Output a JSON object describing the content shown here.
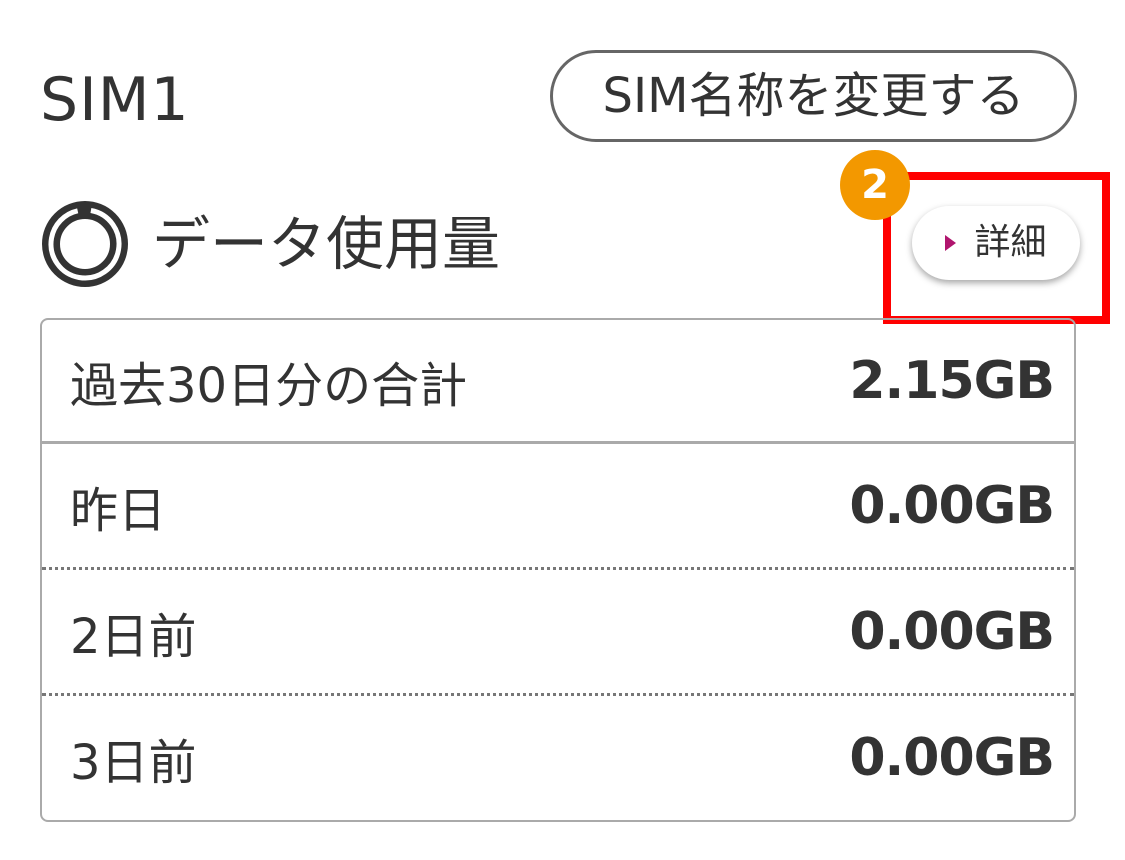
{
  "sim": {
    "title": "SIM1",
    "rename_label": "SIM名称を変更する"
  },
  "usage": {
    "icon": "donut-chart-icon",
    "title": "データ使用量",
    "detail_label": "詳細",
    "detail_icon": "play-triangle-icon",
    "accent_color": "#b0156e"
  },
  "annotation": {
    "step": "2",
    "badge_color": "#f39800",
    "highlight_color": "#ff0000"
  },
  "table": {
    "total": {
      "label": "過去30日分の合計",
      "value": "2.15GB"
    },
    "rows": [
      {
        "label": "昨日",
        "value": "0.00GB"
      },
      {
        "label": "2日前",
        "value": "0.00GB"
      },
      {
        "label": "3日前",
        "value": "0.00GB"
      }
    ]
  }
}
